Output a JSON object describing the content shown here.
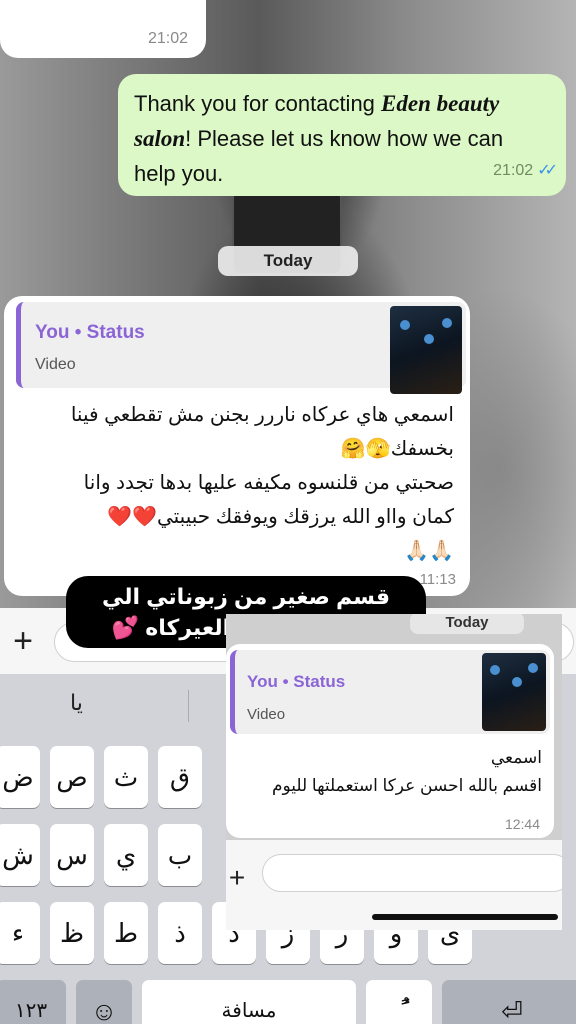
{
  "chat": {
    "top_stub_time": "21:02",
    "outgoing": {
      "text_before": "Thank you for contacting ",
      "brand": "Eden beauty salon",
      "text_after": "! Please let us know how we can help you.",
      "time": "21:02",
      "ticks": "✓✓"
    },
    "day_divider": "Today",
    "incoming": {
      "quote_who": "You • Status",
      "quote_kind": "Video",
      "lines": [
        "اسمعي هاي عركاه ناررر بجنن مش تقطعي فينا",
        "بخسفك🫣🤗",
        "صحبتي من قلنسوه مكيفه عليها بدها تجدد وانا",
        "كمان وااو الله يرزقك ويوفقك حبيبتي❤️❤️",
        "🙏🏻🙏🏻"
      ],
      "time": "11:13"
    }
  },
  "caption": {
    "line1": "قسم صغير من زبوناتي الي",
    "line2": "مداومات على العيركاه 💕"
  },
  "inset": {
    "day_divider": "Today",
    "quote_who": "You • Status",
    "quote_kind": "Video",
    "line1": "اسمعي",
    "line2": "اقسم بالله احسن عركا استعملتها لليوم",
    "time": "12:44",
    "plus": "+"
  },
  "input": {
    "plus": "+"
  },
  "keyboard": {
    "suggestion": "يا",
    "row1": [
      "ض",
      "ص",
      "ث",
      "ق"
    ],
    "row2": [
      "ش",
      "س",
      "ي",
      "ب"
    ],
    "row3": [
      "ء",
      "ظ",
      "ط",
      "ذ",
      "د",
      "ز",
      "ر",
      "و",
      "ى"
    ],
    "numbers_label": "١٢٣",
    "emoji_label": "☺",
    "space_label": "مسافة",
    "diacritic_label": "ًُ",
    "return_label": "⏎"
  }
}
